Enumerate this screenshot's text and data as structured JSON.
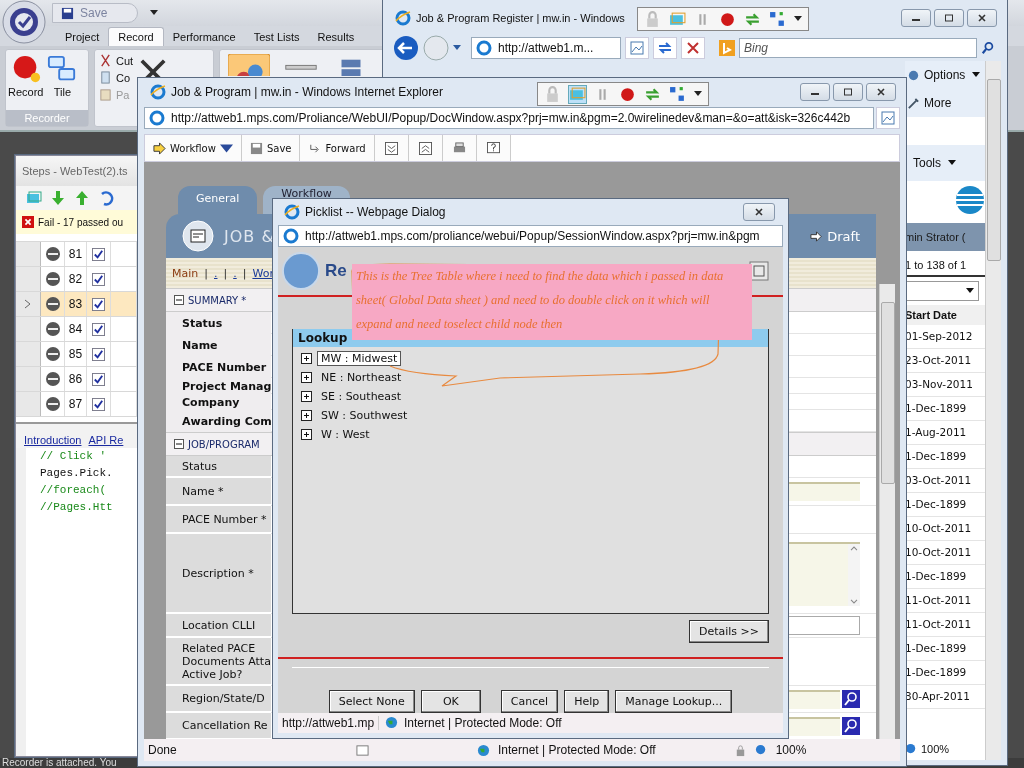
{
  "app": {
    "save": "Save",
    "tabs": [
      {
        "label": "Project",
        "selected": false
      },
      {
        "label": "Record",
        "selected": true
      },
      {
        "label": "Performance",
        "selected": false
      },
      {
        "label": "Test Lists",
        "selected": false
      },
      {
        "label": "Results",
        "selected": false
      }
    ],
    "ribbon": {
      "record": "Record",
      "tile": "Tile",
      "group": "Recorder",
      "cut": "Cut",
      "copy": "Co",
      "paste": "Pa"
    },
    "status": "Recorder is attached. You"
  },
  "steps": {
    "title": "Steps - WebTest(2).ts",
    "result": "Fail - 17 passed ou",
    "rows": [
      {
        "number": "81",
        "checked": true,
        "selected": false
      },
      {
        "number": "82",
        "checked": true,
        "selected": false
      },
      {
        "number": "83",
        "checked": true,
        "selected": true
      },
      {
        "number": "84",
        "checked": true,
        "selected": false
      },
      {
        "number": "85",
        "checked": true,
        "selected": false
      },
      {
        "number": "86",
        "checked": true,
        "selected": false
      },
      {
        "number": "87",
        "checked": true,
        "selected": false
      }
    ],
    "links": [
      "Introduction",
      "API Re"
    ],
    "code": [
      {
        "text": "// Click '",
        "kind": "comment"
      },
      {
        "text": "Pages.Pick.",
        "kind": "code"
      },
      {
        "text": "//foreach(",
        "kind": "comment"
      },
      {
        "text": "//Pages.Htt",
        "kind": "comment"
      }
    ]
  },
  "register": {
    "title": "Job & Program Register | mw.in - Windows",
    "address": "http://attweb1.m...",
    "search": {
      "placeholder": "Bing"
    },
    "commands": [
      "Options",
      "More",
      "Tools"
    ],
    "user": "min Strator (",
    "paging": "1 to 138 of 1",
    "column": "Start Date",
    "dates": [
      "01-Sep-2012",
      "23-Oct-2011",
      "03-Nov-2011",
      "1-Dec-1899",
      "1-Aug-2011",
      "1-Dec-1899",
      "03-Oct-2011",
      "1-Dec-1899",
      "10-Oct-2011",
      "10-Oct-2011",
      "1-Dec-1899",
      "11-Oct-2011",
      "11-Oct-2011",
      "1-Dec-1899",
      "1-Dec-1899",
      "30-Apr-2011"
    ],
    "zoom": "100%"
  },
  "job": {
    "title": "Job & Program | mw.in - Windows Internet Explorer",
    "url": "http://attweb1.mps.com/Proliance/WebUI/Popup/DocWindow.aspx?prj=mw.in&pgm=2.0wirelinedev&man=&o=att&isk=326c442b",
    "toolbar": [
      "Workflow",
      "Save",
      "Forward"
    ],
    "tabs": [
      {
        "label": "General",
        "selected": true
      },
      {
        "label": "Workflow",
        "selected": false
      }
    ],
    "heading": "JOB &",
    "state": "Draft",
    "nav": [
      {
        "label": "Main",
        "kind": "current"
      },
      {
        "label": "|",
        "kind": "sep"
      },
      {
        "label": ".",
        "kind": "link"
      },
      {
        "label": "|",
        "kind": "sep"
      },
      {
        "label": ".",
        "kind": "link"
      },
      {
        "label": "|",
        "kind": "sep"
      },
      {
        "label": "Wor",
        "kind": "link"
      }
    ],
    "sections": [
      {
        "title": "SUMMARY *",
        "expanded": true,
        "kind": "summary",
        "fields": [
          {
            "label": "Status",
            "kind": "plain"
          },
          {
            "label": "Name",
            "kind": "plain"
          },
          {
            "label": "PACE Number",
            "kind": "plain"
          },
          {
            "label": "Project Manag",
            "kind": "plain"
          },
          {
            "label": "Company",
            "kind": "plain"
          },
          {
            "label": "Awarding Com",
            "kind": "plain"
          }
        ]
      },
      {
        "title": "JOB/PROGRAM",
        "expanded": true,
        "kind": "form",
        "fields": [
          {
            "label": "Status",
            "kind": "plain"
          },
          {
            "label": "Name *",
            "kind": "input"
          },
          {
            "label": "PACE Number *",
            "kind": "plain"
          },
          {
            "label": "Description *",
            "kind": "textarea"
          },
          {
            "label": "Location CLLI",
            "kind": "text"
          },
          {
            "label": "Related PACE Documents Atta Active Job?",
            "kind": "plain"
          },
          {
            "label": "Region/State/D",
            "kind": "lookup"
          },
          {
            "label": "Cancellation Re",
            "kind": "lookup"
          }
        ]
      }
    ],
    "status": "Done",
    "zone": "Internet | Protected Mode: Off",
    "zoom": "100%"
  },
  "picklist": {
    "title": "Picklist -- Webpage Dialog",
    "url": "http://attweb1.mps.com/proliance/webui/Popup/SessionWindow.aspx?prj=mw.in&pgm",
    "heading": "Re",
    "column": "Lookup",
    "items": [
      {
        "label": "MW : Midwest",
        "selected": true,
        "expanded": false
      },
      {
        "label": "NE : Northeast",
        "selected": false,
        "expanded": false
      },
      {
        "label": "SE : Southeast",
        "selected": false,
        "expanded": false
      },
      {
        "label": "SW : Southwest",
        "selected": false,
        "expanded": false
      },
      {
        "label": "W : West",
        "selected": false,
        "expanded": false
      }
    ],
    "details": "Details >>",
    "buttons": [
      "Select None",
      "OK",
      "Cancel",
      "Help",
      "Manage Lookup..."
    ],
    "status_url": "http://attweb1.mp",
    "zone": "Internet | Protected Mode: Off"
  },
  "note": {
    "text": "This is the Tree Table where i need to find the data which i passed in data sheet( Global Data sheet ) and need to do double click on it which will expand and need toselect child node then"
  }
}
